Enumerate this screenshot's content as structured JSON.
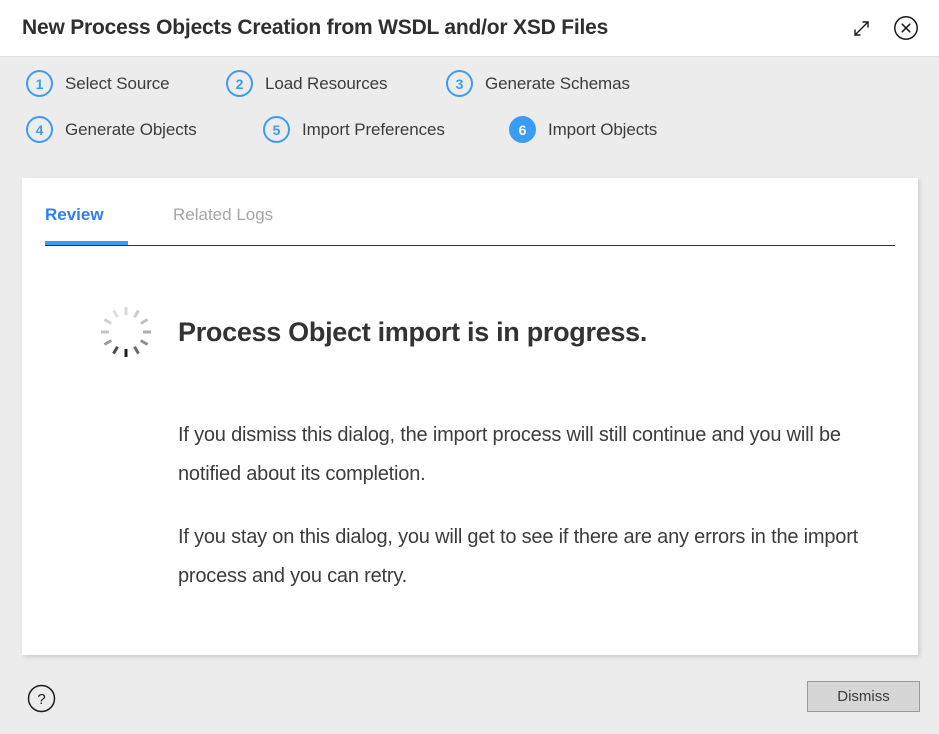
{
  "window": {
    "title": "New Process Objects Creation from WSDL and/or XSD Files",
    "maximize_icon": "expand-diagonal-icon",
    "close_icon": "close-circle-icon"
  },
  "steps": [
    {
      "number": "1",
      "label": "Select Source",
      "active": false
    },
    {
      "number": "2",
      "label": "Load Resources",
      "active": false
    },
    {
      "number": "3",
      "label": "Generate Schemas",
      "active": false
    },
    {
      "number": "4",
      "label": "Generate Objects",
      "active": false
    },
    {
      "number": "5",
      "label": "Import Preferences",
      "active": false
    },
    {
      "number": "6",
      "label": "Import Objects",
      "active": true
    }
  ],
  "tabs": [
    {
      "label": "Review",
      "active": true
    },
    {
      "label": "Related Logs",
      "active": false
    }
  ],
  "status": {
    "spinner_icon": "loading-spinner-icon",
    "heading": "Process Object import is in progress.",
    "paragraphs": [
      "If you dismiss this dialog, the import process will still continue and you will be notified about its completion.",
      "If you stay on this dialog, you will get to see if there are any errors in the import process and you can retry."
    ]
  },
  "footer": {
    "help_icon": "help-circle-icon",
    "dismiss_label": "Dismiss"
  },
  "colors": {
    "accent_blue": "#3b9cf3",
    "tab_active_blue": "#2f7fec",
    "tab_inactive_gray": "#a6a6a6",
    "body_background": "#ececec",
    "panel_background": "#ffffff",
    "button_face": "#d6d6d6"
  }
}
